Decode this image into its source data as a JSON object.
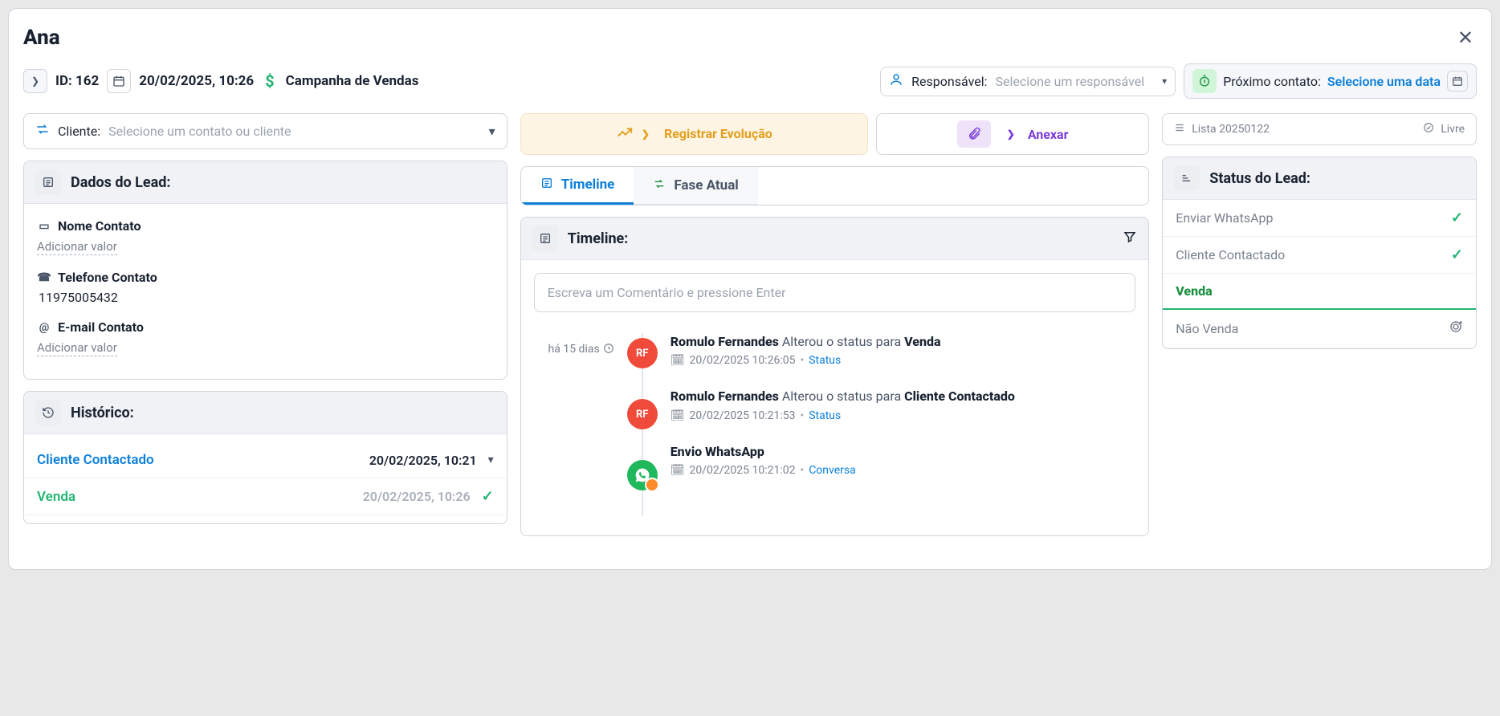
{
  "lead": {
    "name": "Ana",
    "id_label": "ID: 162",
    "datetime": "20/02/2025, 10:26",
    "campaign": "Campanha de Vendas"
  },
  "responsavel": {
    "label": "Responsável:",
    "placeholder": "Selecione um responsável"
  },
  "proximo": {
    "label": "Próximo contato:",
    "link": "Selecione uma data"
  },
  "cliente": {
    "label": "Cliente:",
    "placeholder": "Selecione um contato ou cliente"
  },
  "panels": {
    "dados": "Dados do Lead:",
    "historico": "Histórico:",
    "timeline": "Timeline:",
    "status": "Status do Lead:"
  },
  "fields": {
    "nome_label": "Nome Contato",
    "nome_value": "Adicionar valor",
    "tel_label": "Telefone Contato",
    "tel_value": "11975005432",
    "email_label": "E-mail Contato",
    "email_value": "Adicionar valor"
  },
  "history": [
    {
      "title": "Cliente Contactado",
      "date": "20/02/2025, 10:21",
      "color": "blue",
      "icon": "chevron"
    },
    {
      "title": "Venda",
      "date": "20/02/2025, 10:26",
      "color": "green",
      "icon": "check"
    }
  ],
  "actions": {
    "registrar": "Registrar Evolução",
    "anexar": "Anexar"
  },
  "tabs": {
    "timeline": "Timeline",
    "fase": "Fase Atual"
  },
  "comment_placeholder": "Escreva um Comentário e pressione Enter",
  "timeline_group_label": "há 15 dias",
  "timeline": [
    {
      "avatar": "RF",
      "avatar_color": "red",
      "actor": "Romulo Fernandes",
      "middle": " Alterou o status para ",
      "target": "Venda",
      "ts": "20/02/2025 10:26:05",
      "tag": "Status"
    },
    {
      "avatar": "RF",
      "avatar_color": "red",
      "actor": "Romulo Fernandes",
      "middle": " Alterou o status para ",
      "target": "Cliente Contactado",
      "ts": "20/02/2025 10:21:53",
      "tag": "Status"
    },
    {
      "avatar": "wa",
      "avatar_color": "green",
      "actor": "Envio WhatsApp",
      "middle": "",
      "target": "",
      "ts": "20/02/2025 10:21:02",
      "tag": "Conversa"
    }
  ],
  "list_bar": {
    "name": "Lista 20250122",
    "state": "Livre"
  },
  "statuses": [
    {
      "label": "Enviar WhatsApp",
      "type": "done"
    },
    {
      "label": "Cliente Contactado",
      "type": "done"
    },
    {
      "label": "Venda",
      "type": "current"
    },
    {
      "label": "Não Venda",
      "type": "pending"
    }
  ]
}
